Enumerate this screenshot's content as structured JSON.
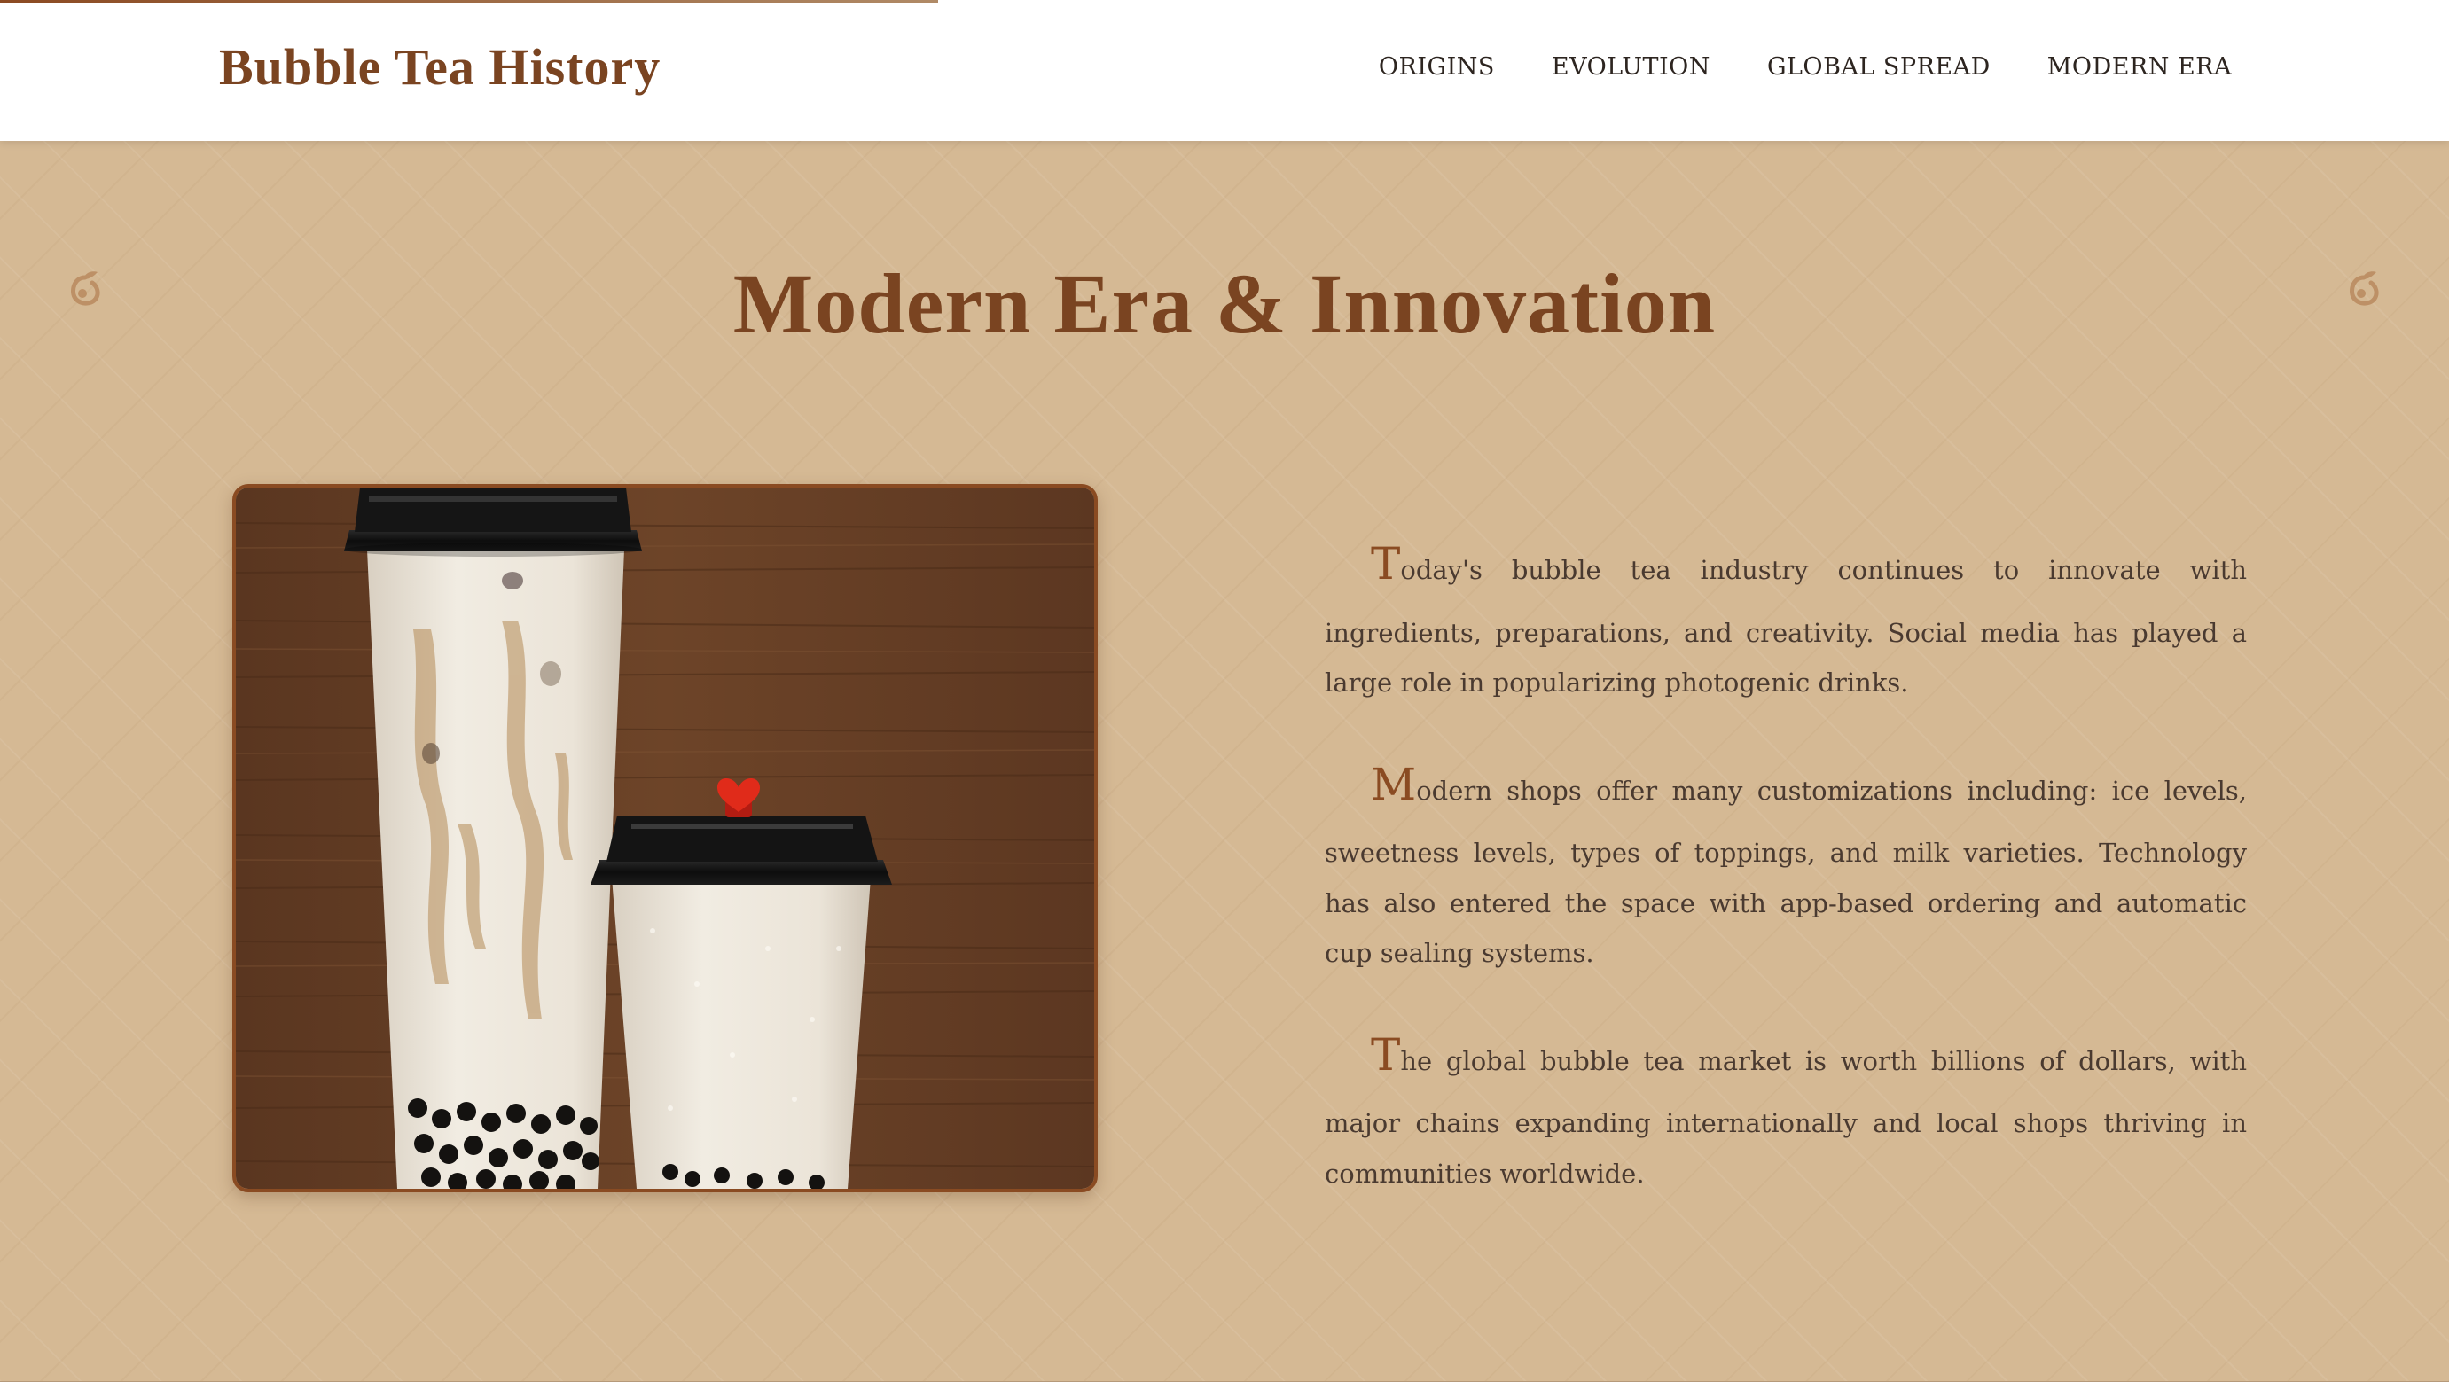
{
  "header": {
    "site_title": "Bubble Tea History",
    "progress_fraction": 0.383,
    "nav": [
      {
        "label": "ORIGINS"
      },
      {
        "label": "EVOLUTION"
      },
      {
        "label": "GLOBAL SPREAD"
      },
      {
        "label": "MODERN ERA"
      }
    ]
  },
  "section": {
    "title": "Modern Era & Innovation",
    "decoration_icon": "tea-leaf-icon",
    "image_description_icon": "bubble-tea-cups-photo",
    "paragraphs": [
      {
        "initial": "T",
        "rest": "oday's bubble tea industry continues to innovate with ingredients, preparations, and creativity. Social media has played a large role in popularizing photogenic drinks."
      },
      {
        "initial": "M",
        "rest": "odern shops offer many customizations including: ice levels, sweetness levels, types of toppings, and milk varieties. Technology has also entered the space with app-based ordering and automatic cup sealing systems."
      },
      {
        "initial": "T",
        "rest": "he global bubble tea market is worth billions of dollars, with major chains expanding internationally and local shops thriving in communities worldwide."
      }
    ]
  },
  "colors": {
    "accent": "#7a4421",
    "background": "#d5b994",
    "text": "#4a3a30",
    "header_bg": "#ffffff"
  }
}
